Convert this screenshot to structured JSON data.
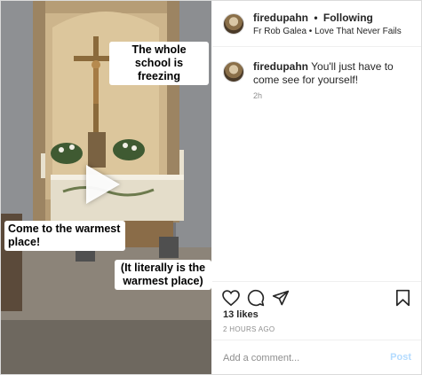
{
  "video": {
    "captions": [
      "The whole school is freezing",
      "Come to the warmest place!",
      "(It literally is the warmest place)"
    ]
  },
  "header": {
    "username": "firedupahn",
    "separator": "•",
    "follow_status": "Following",
    "audio_label": "Fr Rob Galea • Love That Never Fails"
  },
  "comment": {
    "username": "firedupahn",
    "text": "You'll just have to come see for yourself!",
    "time": "2h"
  },
  "actions": {
    "icons": [
      "heart-icon",
      "comment-icon",
      "share-icon",
      "bookmark-icon"
    ]
  },
  "likes": "13 likes",
  "posted_ago": "2 HOURS AGO",
  "add_comment": {
    "placeholder": "Add a comment...",
    "post_label": "Post"
  }
}
